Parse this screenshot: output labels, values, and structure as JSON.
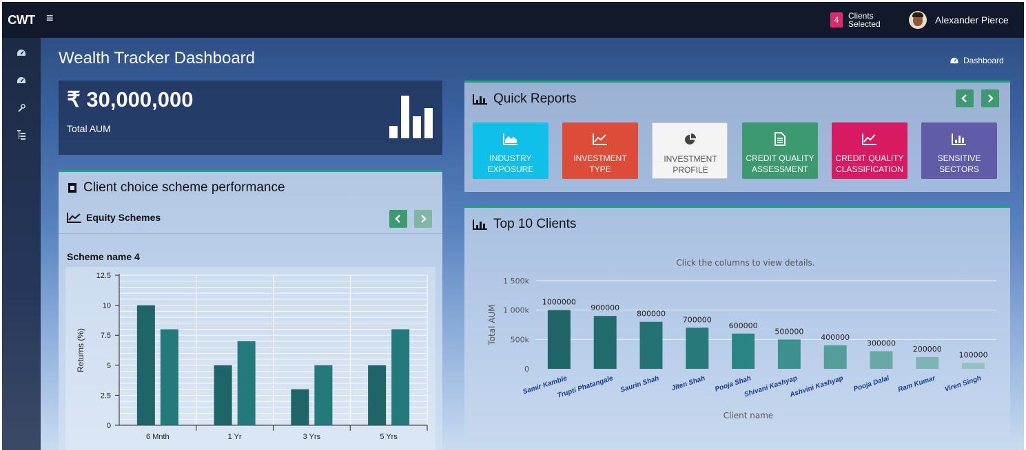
{
  "brand": {
    "logo": "CWT"
  },
  "topbar": {
    "clients_count": "4",
    "clients_label": "Clients Selected",
    "user_name": "Alexander Pierce"
  },
  "sidebar": {
    "items": [
      {
        "icon": "dashboard-icon"
      },
      {
        "icon": "dashboard-icon"
      },
      {
        "icon": "wrench-icon"
      },
      {
        "icon": "sitemap-icon"
      }
    ]
  },
  "header": {
    "title": "Wealth Tracker Dashboard",
    "breadcrumb": "Dashboard"
  },
  "aum": {
    "value": "₹ 30,000,000",
    "label": "Total AUM"
  },
  "client_choice": {
    "title": "Client choice scheme performance",
    "subsection": "Equity Schemes",
    "scheme_name": "Scheme name 4"
  },
  "quick_reports": {
    "title": "Quick Reports",
    "buttons": [
      {
        "label": "INDUSTRY EXPOSURE",
        "color": "#10c0e8",
        "icon": "area-chart-icon"
      },
      {
        "label": "INVESTMENT TYPE",
        "color": "#dd4b39",
        "icon": "line-chart-icon"
      },
      {
        "label": "INVESTMENT PROFILE",
        "color": "#f4f4f4",
        "icon": "pie-chart-icon"
      },
      {
        "label": "CREDIT QUALITY ASSESSMENT",
        "color": "#3d9970",
        "icon": "file-text-icon"
      },
      {
        "label": "CREDIT QUALITY CLASSIFICATION",
        "color": "#d81b60",
        "icon": "line-chart-icon"
      },
      {
        "label": "SENSITIVE SECTORS",
        "color": "#605ca8",
        "icon": "bar-chart-icon"
      }
    ]
  },
  "top_clients": {
    "title": "Top 10 Clients"
  },
  "colors": {
    "accent_green": "#1aa37a",
    "teal_dark": "#1f6466",
    "teal": "#24797a"
  },
  "chart_data": [
    {
      "type": "bar",
      "title": "Scheme name 4",
      "categories": [
        "6 Mnth",
        "1 Yr",
        "3 Yrs",
        "5 Yrs"
      ],
      "series": [
        {
          "values": [
            10,
            5,
            3,
            5
          ]
        },
        {
          "values": [
            8,
            7,
            5,
            8
          ]
        }
      ],
      "xlabel": "",
      "ylabel": "Returns (%)",
      "ylim": [
        0,
        12.5
      ],
      "yticks": [
        "0",
        "2.5",
        "5",
        "7.5",
        "10",
        "12.5"
      ],
      "grid": true
    },
    {
      "type": "bar",
      "subtitle": "Click the columns to view details.",
      "categories": [
        "Samir Kamble",
        "Trupti Phatangale",
        "Saurin Shah",
        "Jiten Shah",
        "Pooja Shah",
        "Shivani Kashyap",
        "Ashvini Kashyap",
        "Pooja Dalal",
        "Ram Kumar",
        "Viren Singh"
      ],
      "values": [
        1000000,
        900000,
        800000,
        700000,
        600000,
        500000,
        400000,
        300000,
        200000,
        100000
      ],
      "data_labels": [
        "1000000",
        "900000",
        "800000",
        "700000",
        "600000",
        "500000",
        "400000",
        "300000",
        "200000",
        "100000"
      ],
      "xlabel": "Client name",
      "ylabel": "Total AUM",
      "ylim": [
        0,
        1500000
      ],
      "yticks": [
        "0",
        "500k",
        "1 000k",
        "1 500k"
      ],
      "grid": true
    }
  ]
}
